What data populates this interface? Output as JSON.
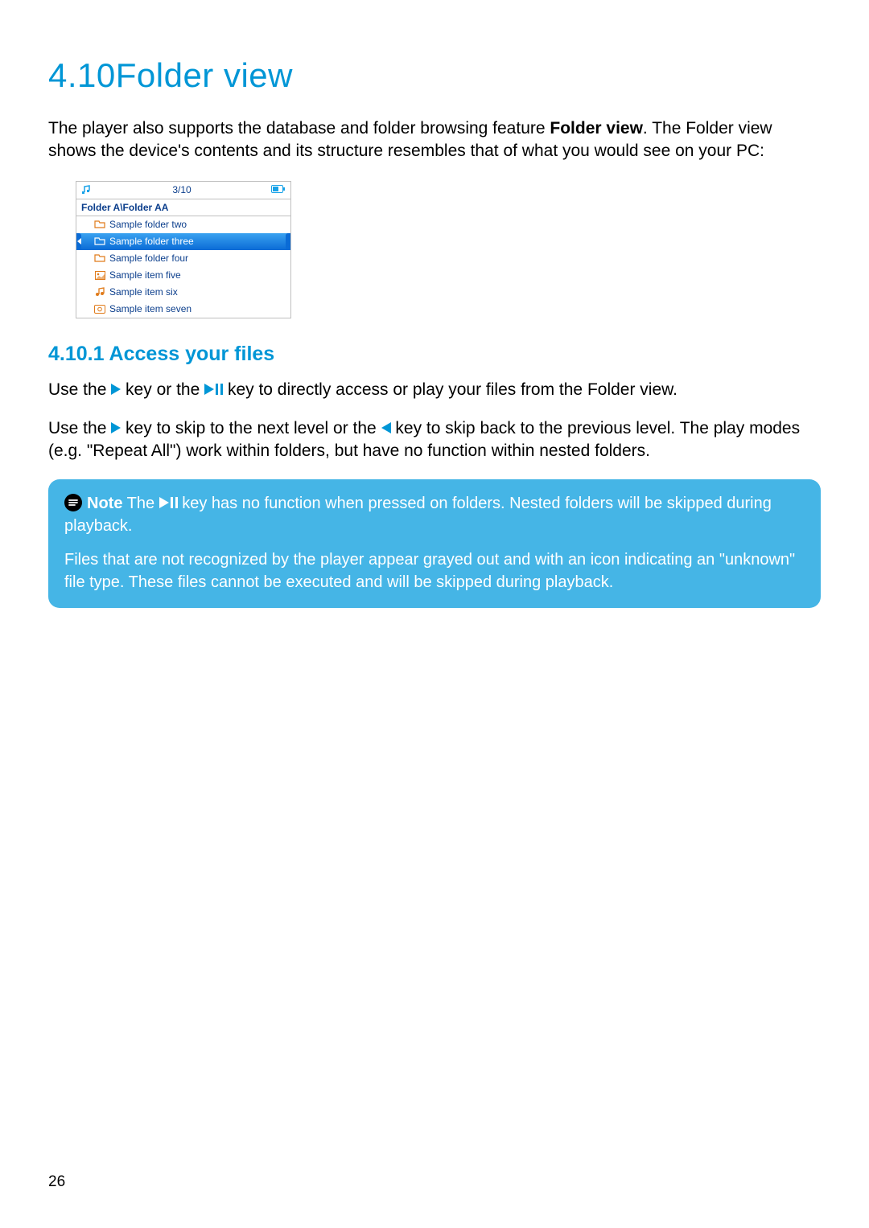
{
  "heading": {
    "number": "4.10",
    "title": "Folder view"
  },
  "intro": {
    "before_bold": "The player also supports the database and folder browsing feature ",
    "bold": "Folder view",
    "after_bold": ". The Folder view shows the device's contents and its structure resembles that of what you would see on your PC:"
  },
  "device": {
    "position": "3/10",
    "path": "Folder A\\Folder AA",
    "rows": [
      {
        "label": "Sample folder two",
        "type": "folder",
        "selected": false
      },
      {
        "label": "Sample folder three",
        "type": "folder",
        "selected": true
      },
      {
        "label": "Sample folder four",
        "type": "folder",
        "selected": false
      },
      {
        "label": "Sample item five",
        "type": "image",
        "selected": false
      },
      {
        "label": "Sample item six",
        "type": "audio",
        "selected": false
      },
      {
        "label": "Sample item seven",
        "type": "video",
        "selected": false
      }
    ]
  },
  "sub": {
    "number": "4.10.1",
    "title": "Access your files"
  },
  "p1": {
    "a": "Use the ",
    "b": " key or the ",
    "c": " key to directly access or play your files from the Folder view."
  },
  "p2": {
    "a": "Use the ",
    "b": " key to skip to the next level or the ",
    "c": " key to skip back to the previous level. The play modes (e.g. \"Repeat All\") work within folders, but have no function within nested folders."
  },
  "note": {
    "label": "Note",
    "line1a": " The ",
    "line1b": " key has no function when pressed on folders. Nested folders will be skipped during playback.",
    "line2": "Files that are not recognized by the player appear grayed out and with an icon indicating an \"unknown\" file type. These files cannot be executed and will be skipped during playback."
  },
  "page_number": "26"
}
